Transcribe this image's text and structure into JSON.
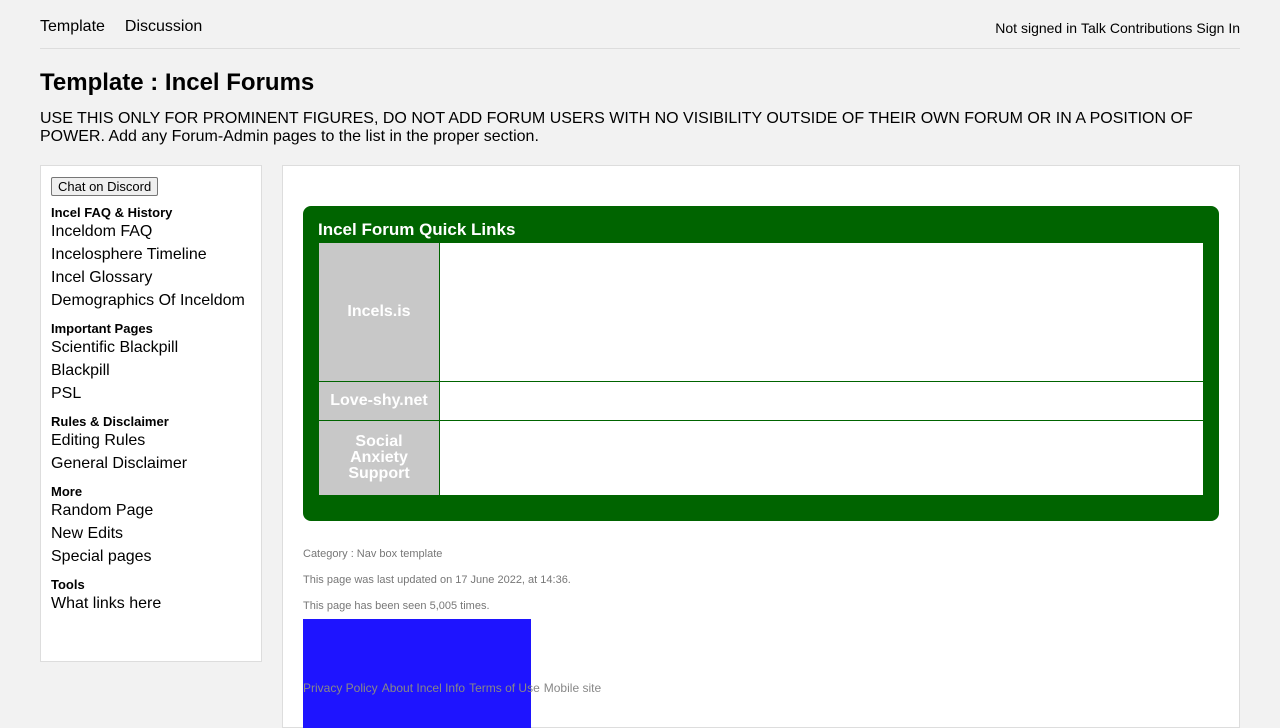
{
  "header": {
    "tabs": [
      "Template",
      "Discussion"
    ],
    "user_links": [
      "Not signed in",
      "Talk",
      "Contributions",
      "Sign In"
    ]
  },
  "page": {
    "title": "Template : Incel Forums",
    "notice": "USE THIS ONLY FOR PROMINENT FIGURES, DO NOT ADD FORUM USERS WITH NO VISIBILITY OUTSIDE OF THEIR OWN FORUM OR IN A POSITION OF POWER. Add any Forum-Admin pages to the list in the proper section."
  },
  "sidebar": {
    "discord_button": "Chat on Discord",
    "sections": [
      {
        "heading": "Incel FAQ & History",
        "items": [
          "Inceldom FAQ",
          "Incelosphere Timeline",
          "Incel Glossary",
          "Demographics Of Inceldom"
        ]
      },
      {
        "heading": "Important Pages",
        "items": [
          "Scientific Blackpill",
          "Blackpill",
          "PSL"
        ]
      },
      {
        "heading": "Rules & Disclaimer",
        "items": [
          "Editing Rules",
          "General Disclaimer"
        ]
      },
      {
        "heading": "More",
        "items": [
          "Random Page",
          "New Edits",
          "Special pages"
        ]
      },
      {
        "heading": "Tools",
        "items": [
          "What links here"
        ]
      }
    ]
  },
  "navbox": {
    "title": "Incel Forum Quick Links",
    "rows": [
      "Incels.is",
      "Love-shy.net",
      "Social Anxiety Support"
    ],
    "colors": {
      "frame": "#006400",
      "group_cell": "#c8c8c8"
    }
  },
  "footer": {
    "category": "Category : Nav box template",
    "last_updated": "This page was last updated on 17 June 2022, at 14:36.",
    "views": "This page has been seen 5,005 times.",
    "links": [
      "Privacy Policy",
      "About Incel Info",
      "Terms of Use",
      "Mobile site"
    ],
    "accent_block_color": "#1e14ff"
  }
}
